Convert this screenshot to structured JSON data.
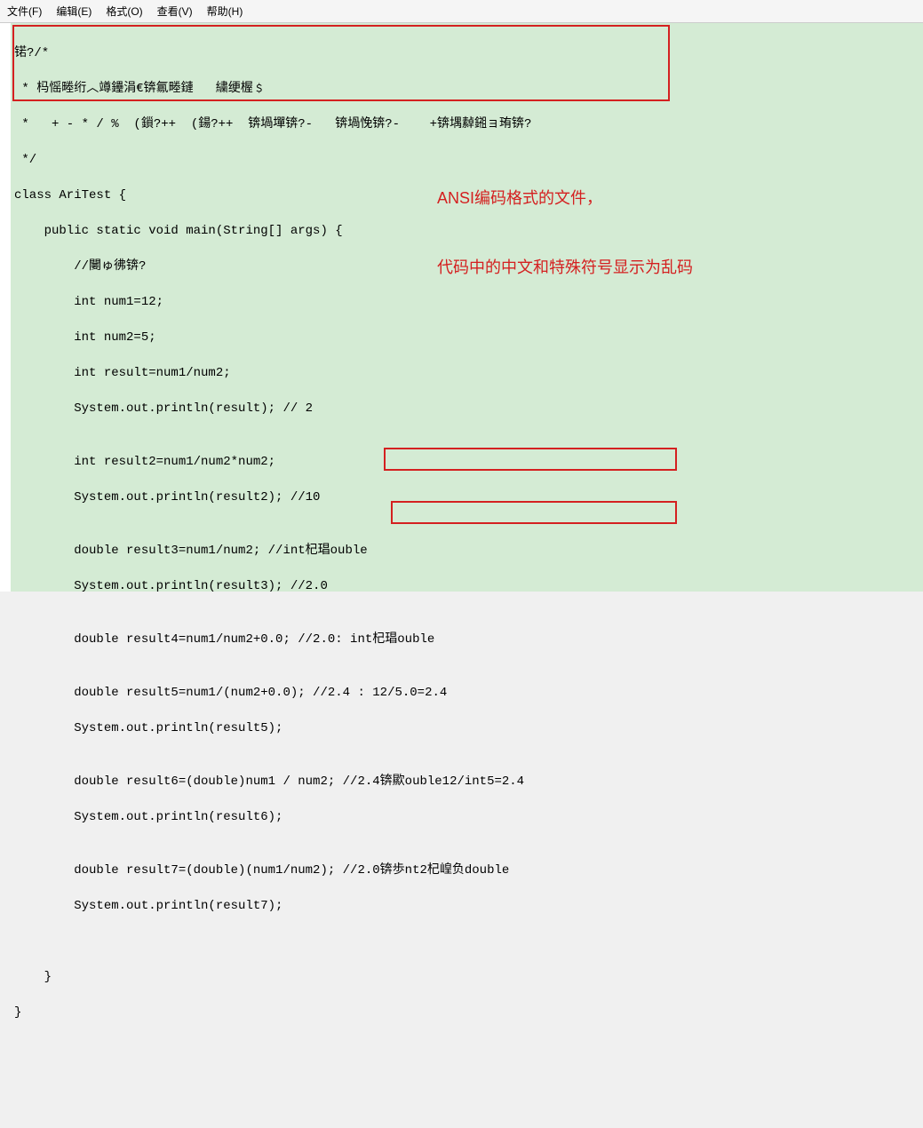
{
  "menubar": {
    "file": "文件(F)",
    "edit": "编辑(E)",
    "format": "格式(O)",
    "view": "查看(V)",
    "help": "帮助(H)"
  },
  "annotation": {
    "line1": "ANSI编码格式的文件，",
    "line2": "代码中的中文和特殊符号显示为乱码"
  },
  "code": {
    "l1": "锘?/*",
    "l2": " * 杩愮畻绗︿竴鑸涓€锛氱畻鏈   繍绠楃﹩",
    "l3": " *   + - * / %  (鎻?++  (鍚?++  锛堝墠锛?-   锛堝悗锛?-    +锛堣繛鎺ョ珛锛?",
    "l4": " */",
    "l5": "class AriTest {",
    "l6": "    public static void main(String[] args) {",
    "l7": "        //闄ゅ彿锛?",
    "l8": "        int num1=12;",
    "l9": "        int num2=5;",
    "l10": "        int result=num1/num2;",
    "l11": "        System.out.println(result); // 2",
    "l12": "",
    "l13": "        int result2=num1/num2*num2;",
    "l14": "        System.out.println(result2); //10",
    "l15": "",
    "l16": "        double result3=num1/num2; //int杞琩ouble",
    "l17": "        System.out.println(result3); //2.0",
    "l18": "",
    "l19": "        double result4=num1/num2+0.0; //2.0: int杞琩ouble",
    "l20": "",
    "l21": "        double result5=num1/(num2+0.0); //2.4 : 12/5.0=2.4",
    "l22": "        System.out.println(result5);",
    "l23": "",
    "l24": "        double result6=(double)num1 / num2; //2.4锛歞ouble12/int5=2.4",
    "l25": "        System.out.println(result6);",
    "l26": "",
    "l27": "        double result7=(double)(num1/num2); //2.0锛歩nt2杞崲负double",
    "l28": "        System.out.println(result7);",
    "l29": "",
    "l30": "",
    "l31": "    }",
    "l32": "}"
  }
}
